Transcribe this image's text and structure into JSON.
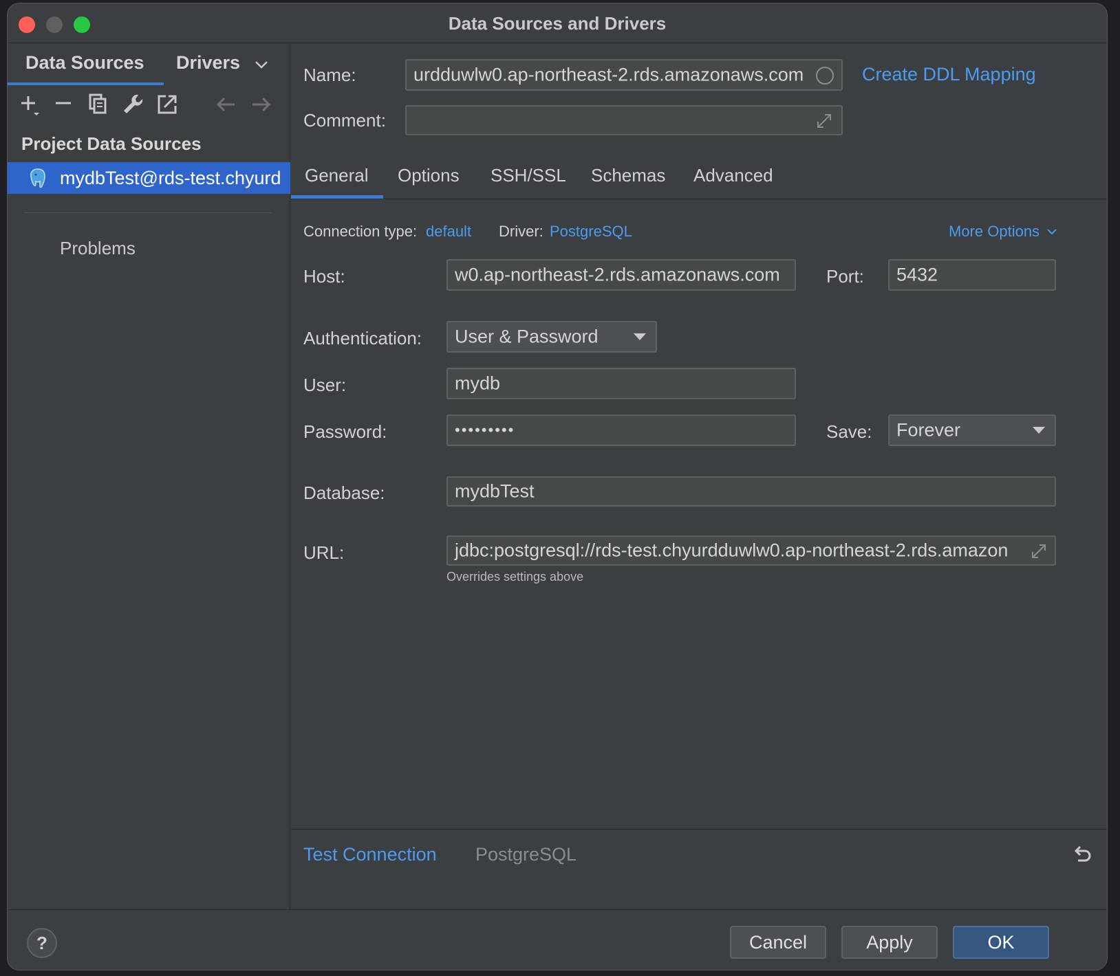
{
  "window": {
    "title": "Data Sources and Drivers"
  },
  "sidebar": {
    "tabs": [
      "Data Sources",
      "Drivers"
    ],
    "section_header": "Project Data Sources",
    "selected_item": "mydbTest@rds-test.chyurd",
    "problems": "Problems"
  },
  "form": {
    "name_label": "Name:",
    "name_value": "urdduwlw0.ap-northeast-2.rds.amazonaws.com",
    "create_ddl": "Create DDL Mapping",
    "comment_label": "Comment:",
    "comment_value": "",
    "tabs": [
      "General",
      "Options",
      "SSH/SSL",
      "Schemas",
      "Advanced"
    ],
    "connection_type_label": "Connection type:",
    "connection_type_value": "default",
    "driver_label": "Driver:",
    "driver_value": "PostgreSQL",
    "more_options": "More Options",
    "host_label": "Host:",
    "host_value": "w0.ap-northeast-2.rds.amazonaws.com",
    "port_label": "Port:",
    "port_value": "5432",
    "auth_label": "Authentication:",
    "auth_value": "User & Password",
    "user_label": "User:",
    "user_value": "mydb",
    "password_label": "Password:",
    "password_value": "•••••••••",
    "save_label": "Save:",
    "save_value": "Forever",
    "database_label": "Database:",
    "database_value": "mydbTest",
    "url_label": "URL:",
    "url_value": "jdbc:postgresql://rds-test.chyurdduwlw0.ap-northeast-2.rds.amazon",
    "url_hint": "Overrides settings above"
  },
  "bottom": {
    "test_connection": "Test Connection",
    "driver_name": "PostgreSQL"
  },
  "footer": {
    "help": "?",
    "cancel": "Cancel",
    "apply": "Apply",
    "ok": "OK"
  }
}
